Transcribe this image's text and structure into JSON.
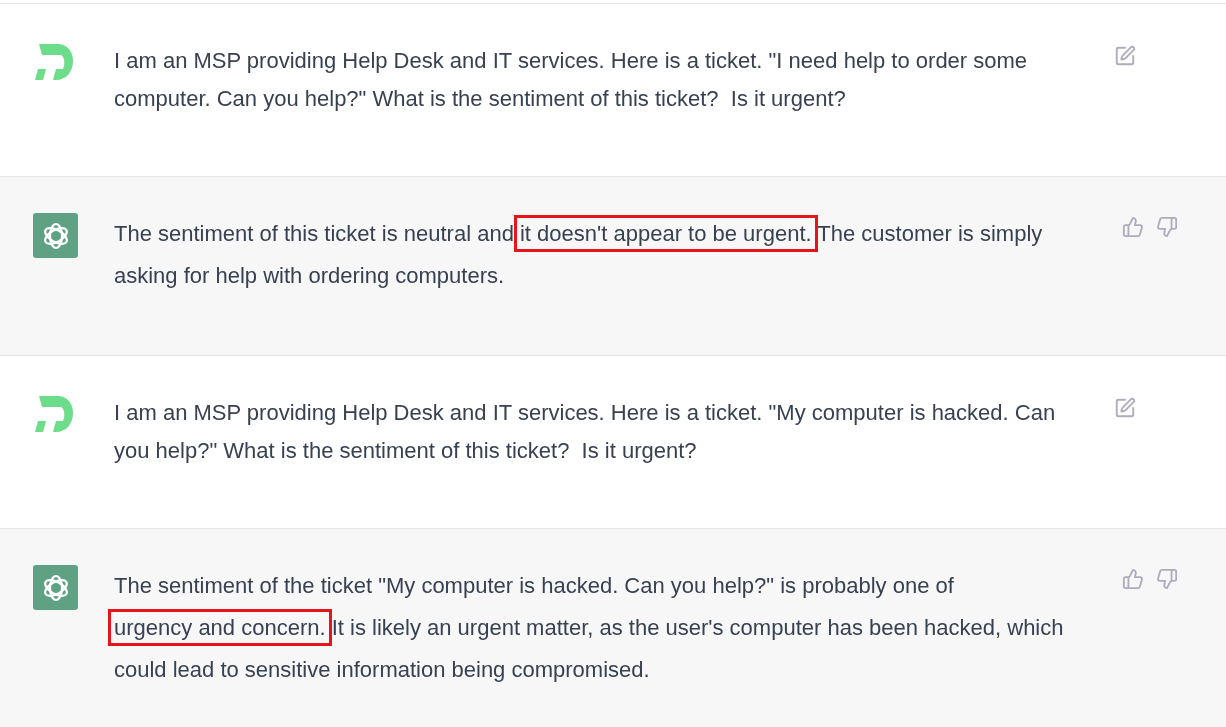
{
  "messages": [
    {
      "kind": "user",
      "parts": [
        {
          "kind": "plain",
          "text": "I am an MSP providing Help Desk and IT services. Here is a ticket. \"I need help to order some computer. Can you help?\" What is the sentiment of this ticket?  Is it urgent?"
        }
      ]
    },
    {
      "kind": "assistant",
      "parts": [
        {
          "kind": "plain",
          "text": "The sentiment of this ticket is neutral and "
        },
        {
          "kind": "highlight",
          "text": "it doesn't appear to be urgent."
        },
        {
          "kind": "plain",
          "text": " The customer is simply asking for help with ordering computers."
        }
      ]
    },
    {
      "kind": "user",
      "parts": [
        {
          "kind": "plain",
          "text": "I am an MSP providing Help Desk and IT services. Here is a ticket. \"My computer is hacked. Can you help?\" What is the sentiment of this ticket?  Is it urgent?"
        }
      ]
    },
    {
      "kind": "assistant",
      "parts": [
        {
          "kind": "plain",
          "text": "The sentiment of the ticket \"My computer is hacked. Can you help?\" is probably one of "
        },
        {
          "kind": "highlight",
          "text": "urgency and concern."
        },
        {
          "kind": "plain",
          "text": " It is likely an urgent matter, as the user's computer has been hacked, which could lead to sensitive information being compromised."
        }
      ]
    }
  ]
}
